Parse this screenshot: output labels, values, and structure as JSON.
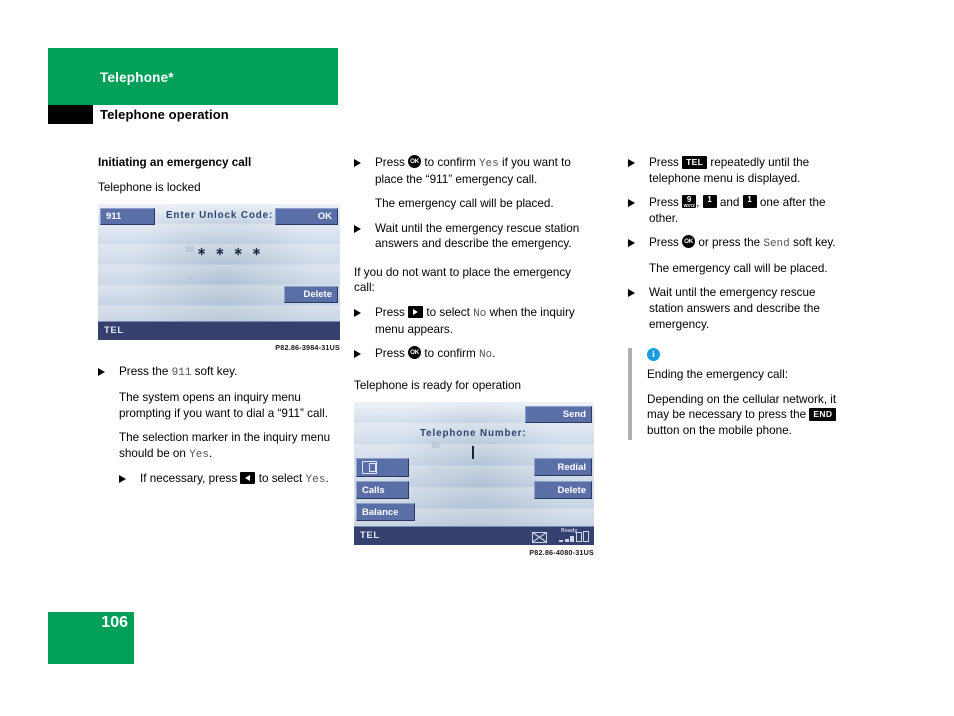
{
  "header": {
    "chapter": "Telephone*",
    "section": "Telephone operation"
  },
  "footer": {
    "page_number": "106"
  },
  "colors": {
    "brand_green": "#00a05a",
    "screen_button_blue": "#5a6fa8",
    "status_bar_navy": "#36406e",
    "info_icon_blue": "#1b9ce0"
  },
  "column_left": {
    "heading": "Initiating an emergency call",
    "subheading": "Telephone is locked",
    "figure": {
      "caption": "P82.86-3984-31US",
      "soft_key_911": "911",
      "title": "Enter Unlock Code:",
      "ok_button": "OK",
      "delete_button": "Delete",
      "pin_masked": "∗ ∗ ∗ ∗",
      "status_label": "TEL"
    },
    "steps": [
      {
        "pre": "Press the ",
        "code": "911",
        "post": " soft key."
      }
    ],
    "para_1": "The system opens an inquiry menu prompting if you want to dial a “911” call.",
    "para_2_pre": "The selection marker in the inquiry menu should be on ",
    "para_2_code": "Yes",
    "para_2_post": ".",
    "substep": {
      "pre": "If necessary, press ",
      "key": "left-arrow-key",
      "mid": " to select ",
      "code": "Yes",
      "post": "."
    }
  },
  "column_middle": {
    "step_1": {
      "pre": "Press ",
      "key": "ok-key",
      "mid": " to confirm ",
      "code": "Yes",
      "post": " if you want to place the “911” emergency call."
    },
    "result_1": "The emergency call will be placed.",
    "step_2": "Wait until the emergency rescue station answers and describe the emergency.",
    "para_if_not": "If you do not want to place the emergency call:",
    "step_3": {
      "pre": "Press ",
      "key": "right-arrow-key",
      "mid": " to select ",
      "code": "No",
      "post": " when the inquiry menu appears."
    },
    "step_4": {
      "pre": "Press ",
      "key": "ok-key",
      "mid": " to confirm ",
      "code": "No",
      "post": "."
    },
    "subheading": "Telephone is ready for operation",
    "figure": {
      "caption": "P82.86-4080-31US",
      "title": "Telephone Number:",
      "send_button": "Send",
      "redial_button": "Redial",
      "delete_button": "Delete",
      "calls_button": "Calls",
      "balance_button": "Balance",
      "phonebook_button": "phonebook-icon",
      "status_label": "TEL",
      "status_ready": "Ready",
      "status_message_icon": "envelope-icon"
    }
  },
  "column_right": {
    "step_1": {
      "pre": "Press ",
      "key_label": "TEL",
      "post": " repeatedly until the telephone menu is displayed."
    },
    "step_2": {
      "pre": "Press ",
      "key_9_digit": "9",
      "key_9_letters": "WXYZ",
      "mid": ", ",
      "key_1_a": "1",
      "and": " and ",
      "key_1_b": "1",
      "post": " one after the other."
    },
    "step_3": {
      "pre": "Press ",
      "key": "ok-key",
      "mid": " or press the ",
      "code": "Send",
      "post": " soft key."
    },
    "result": "The emergency call will be placed.",
    "step_4": "Wait until the emergency rescue station answers and describe the emergency.",
    "note": {
      "icon": "info-icon",
      "title": "Ending the emergency call:",
      "body_pre": "Depending on the cellular network, it may be necessary to press the ",
      "key_label": "END",
      "body_post": " button on the mobile phone."
    }
  }
}
